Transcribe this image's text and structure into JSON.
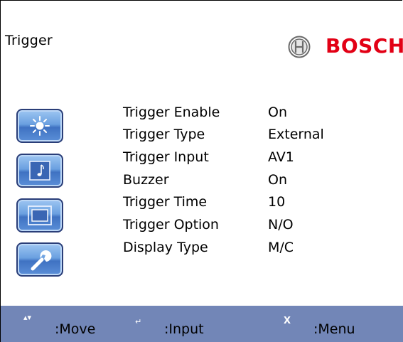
{
  "header": {
    "title": "Trigger",
    "brand": "BOSCH"
  },
  "settings": [
    {
      "label": "Trigger Enable",
      "value": "On"
    },
    {
      "label": "Trigger Type",
      "value": "External"
    },
    {
      "label": "Trigger Input",
      "value": "AV1"
    },
    {
      "label": "Buzzer",
      "value": "On"
    },
    {
      "label": "Trigger Time",
      "value": "10"
    },
    {
      "label": "Trigger Option",
      "value": "N/O"
    },
    {
      "label": "Display Type",
      "value": "M/C"
    }
  ],
  "menu_icons": [
    "brightness-icon",
    "audio-note-icon",
    "display-window-icon",
    "wrench-icon"
  ],
  "footer": {
    "move": ":Move",
    "input": ":Input",
    "menu": ":Menu",
    "move_icon": "▴▾",
    "input_icon": "↵",
    "menu_icon": "X"
  },
  "colors": {
    "brand_red": "#e20015",
    "footer_bg": "#7286b7",
    "button_blue": "#5b8fd8"
  }
}
